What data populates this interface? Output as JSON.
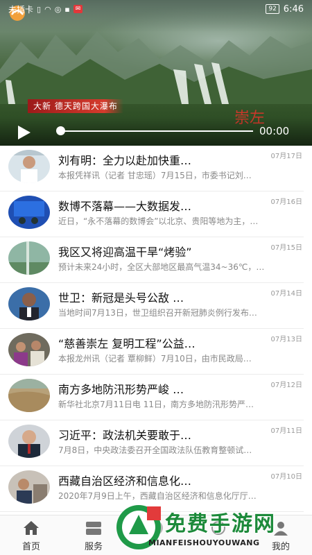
{
  "status_bar": {
    "carrier": "未插卡",
    "battery": "92",
    "time": "6:46"
  },
  "video": {
    "caption": "大新  德天跨国大瀑布",
    "corner_mark": "崇左",
    "progress": 0,
    "time": "00:00"
  },
  "news": [
    {
      "title": "刘有明：全力以赴加快重…",
      "date": "07月17日",
      "summary": "本报凭祥讯（记者 甘忠瑶）7月15日，市委书记刘…"
    },
    {
      "title": "数博不落幕——大数据发…",
      "date": "07月16日",
      "summary": "近日，“永不落幕的数博会”以北京、贵阳等地为主，…"
    },
    {
      "title": "我区又将迎高温干旱“烤验”",
      "date": "07月15日",
      "summary": "预计未来24小时，全区大部地区最高气温34~36℃，…"
    },
    {
      "title": "世卫：新冠是头号公敌 …",
      "date": "07月14日",
      "summary": "当地时间7月13日，世卫组织召开新冠肺炎例行发布…"
    },
    {
      "title": "“慈善崇左 复明工程”公益…",
      "date": "07月13日",
      "summary": "本报龙州讯（记者 覃柳鲜）7月10日，由市民政局…"
    },
    {
      "title": "南方多地防汛形势严峻 …",
      "date": "07月12日",
      "summary": "新华社北京7月11日电 11日，南方多地防汛形势严…"
    },
    {
      "title": "习近平：政法机关要敢于…",
      "date": "07月11日",
      "summary": "7月8日，中央政法委召开全国政法队伍教育整顿试…"
    },
    {
      "title": "西藏自治区经济和信息化…",
      "date": "07月10日",
      "summary": "2020年7月9日上午，西藏自治区经济和信息化厅厅…"
    }
  ],
  "bottom_nav": [
    {
      "label": "首页",
      "icon": "home-icon"
    },
    {
      "label": "服务",
      "icon": "service-icon"
    },
    {
      "label": "",
      "icon": "center-icon"
    },
    {
      "label": "",
      "icon": "discover-icon"
    },
    {
      "label": "我的",
      "icon": "profile-icon"
    }
  ],
  "watermark": {
    "title": "免费手游网",
    "subtitle": "MIANFEISHOUYOUWANG"
  }
}
